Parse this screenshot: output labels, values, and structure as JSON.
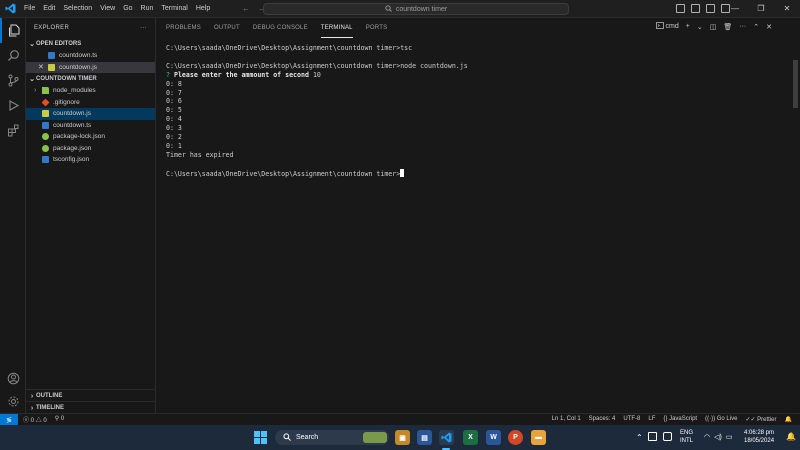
{
  "titlebar": {
    "menu": [
      "File",
      "Edit",
      "Selection",
      "View",
      "Go",
      "Run",
      "Terminal",
      "Help"
    ],
    "search_text": "countdown timer"
  },
  "sidebar": {
    "header": "EXPLORER",
    "open_editors_title": "OPEN EDITORS",
    "open_editors": [
      "countdown.ts",
      "countdown.js"
    ],
    "folder_title": "COUNTDOWN TIMER",
    "files": [
      "node_modules",
      ".gitignore",
      "countdown.js",
      "countdown.ts",
      "package-lock.json",
      "package.json",
      "tsconfig.json"
    ],
    "outline_title": "OUTLINE",
    "timeline_title": "TIMELINE"
  },
  "panel": {
    "tabs": [
      "PROBLEMS",
      "OUTPUT",
      "DEBUG CONSOLE",
      "TERMINAL",
      "PORTS"
    ],
    "active_tab": "TERMINAL",
    "shell_label": "cmd"
  },
  "terminal": {
    "cmd1": "C:\\Users\\saada\\OneDrive\\Desktop\\Assignment\\countdown timer>tsc",
    "cmd2": "C:\\Users\\saada\\OneDrive\\Desktop\\Assignment\\countdown timer>node countdown.js",
    "prompt_mark": "?",
    "prompt_text": "Please enter the ammount of second",
    "prompt_answer": "10",
    "countdown": [
      "0: 8",
      "0: 7",
      "0: 6",
      "0: 5",
      "0: 4",
      "0: 3",
      "0: 2",
      "0: 1"
    ],
    "expired": "Timer has expired",
    "cmd3": "C:\\Users\\saada\\OneDrive\\Desktop\\Assignment\\countdown timer>"
  },
  "statusbar": {
    "errors": "0",
    "warnings": "0",
    "ports": "0",
    "position": "Ln 1, Col 1",
    "spaces": "Spaces: 4",
    "encoding": "UTF-8",
    "eol": "LF",
    "language": "JavaScript",
    "golive": "Go Live",
    "prettier": "Prettier"
  },
  "taskbar": {
    "search_label": "Search",
    "lang_top": "ENG",
    "lang_bottom": "INTL",
    "time": "4:06:28 pm",
    "date": "18/05/2024"
  },
  "colors": {
    "accent": "#0078d4",
    "terminal_green": "#23d18b",
    "editor_bg": "#181818",
    "taskbar_bg": "#1c2a3c"
  },
  "icons": [
    "vscode-logo-icon",
    "files-icon",
    "search-icon",
    "source-control-icon",
    "run-debug-icon",
    "extensions-icon",
    "account-icon",
    "settings-gear-icon",
    "windows-start-icon"
  ]
}
